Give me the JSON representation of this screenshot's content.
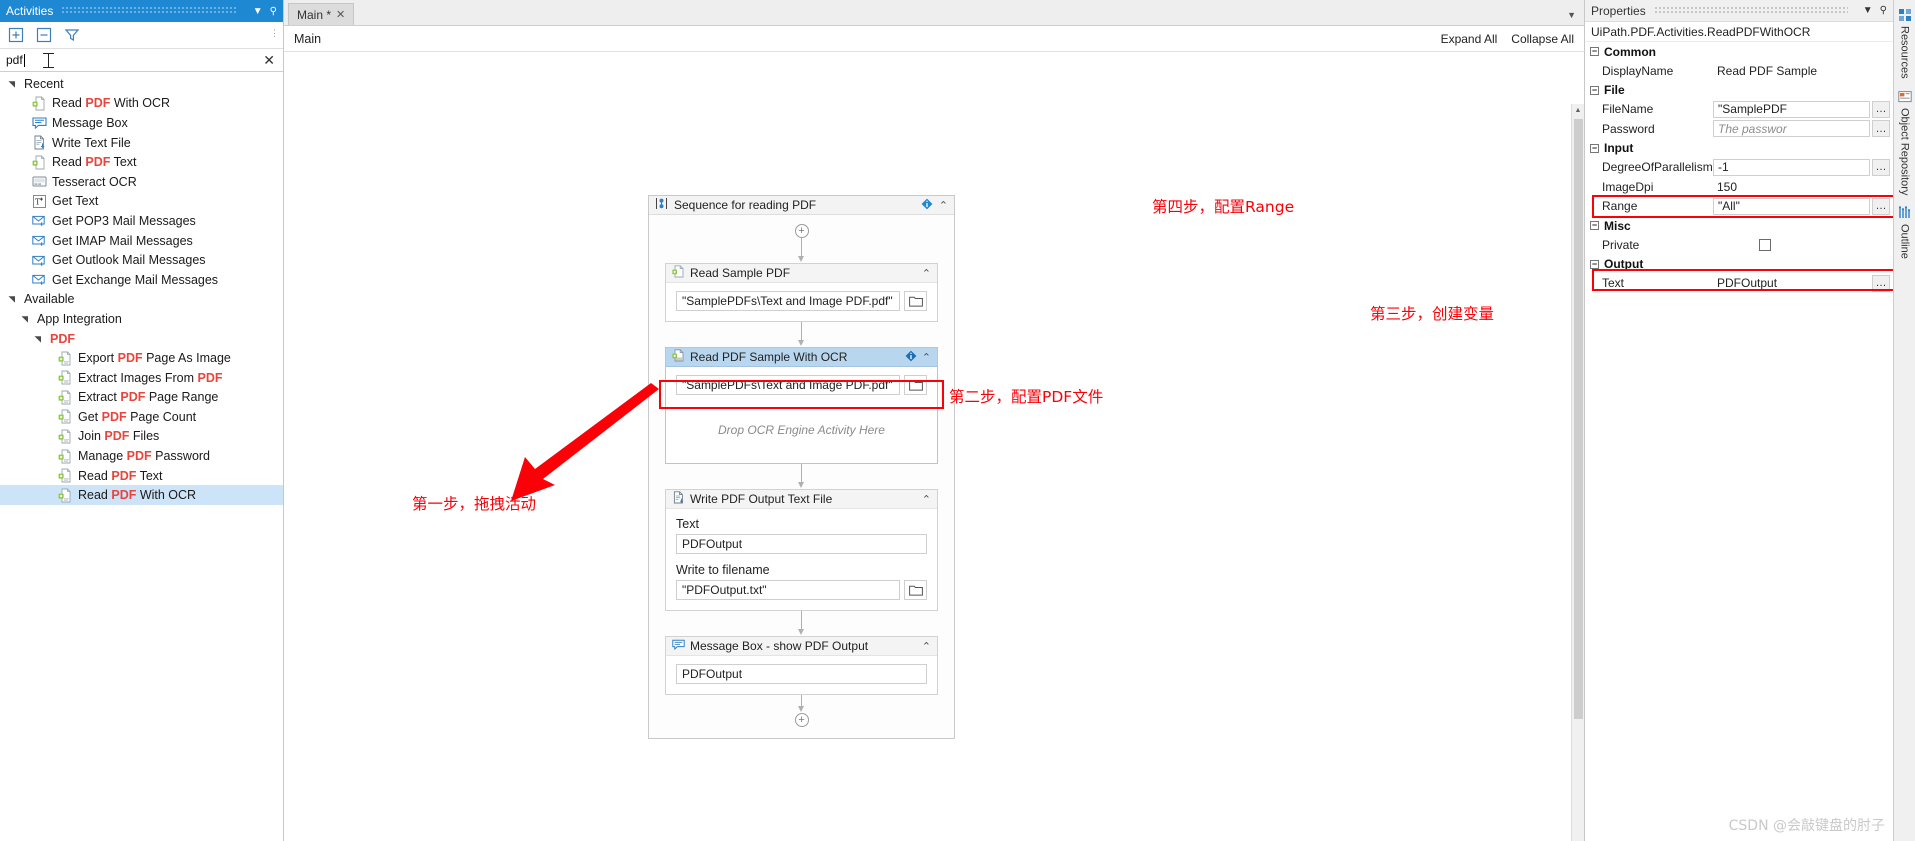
{
  "activities": {
    "title": "Activities",
    "toolbar": {
      "expand_all": "expand-all-icon",
      "collapse_all": "collapse-all-icon",
      "filter": "filter-icon"
    },
    "search": {
      "value": "pdf",
      "clear_label": "✕"
    },
    "tree": [
      {
        "type": "group",
        "label": "Recent",
        "indent": 0,
        "expanded": true
      },
      {
        "type": "item",
        "label": "Read PDF With OCR",
        "indent": 2,
        "icon": "read-pdf-icon"
      },
      {
        "type": "item",
        "label": "Message Box",
        "indent": 2,
        "icon": "message-box-icon"
      },
      {
        "type": "item",
        "label": "Write Text File",
        "indent": 2,
        "icon": "write-text-icon"
      },
      {
        "type": "item",
        "label": "Read PDF Text",
        "indent": 2,
        "icon": "read-pdf-icon"
      },
      {
        "type": "item",
        "label": "Tesseract OCR",
        "indent": 2,
        "icon": "ocr-icon"
      },
      {
        "type": "item",
        "label": "Get Text",
        "indent": 2,
        "icon": "get-text-icon"
      },
      {
        "type": "item",
        "label": "Get POP3 Mail Messages",
        "indent": 2,
        "icon": "mail-icon"
      },
      {
        "type": "item",
        "label": "Get IMAP Mail Messages",
        "indent": 2,
        "icon": "mail-icon"
      },
      {
        "type": "item",
        "label": "Get Outlook Mail Messages",
        "indent": 2,
        "icon": "mail-icon"
      },
      {
        "type": "item",
        "label": "Get Exchange Mail Messages",
        "indent": 2,
        "icon": "mail-icon"
      },
      {
        "type": "group",
        "label": "Available",
        "indent": 0,
        "expanded": true
      },
      {
        "type": "group",
        "label": "App Integration",
        "indent": 1,
        "expanded": true
      },
      {
        "type": "group",
        "label": "PDF",
        "indent": 2,
        "expanded": true,
        "accent": true
      },
      {
        "type": "item",
        "label": "Export PDF Page As Image",
        "indent": 4,
        "icon": "pdf-doc-icon"
      },
      {
        "type": "item",
        "label": "Extract Images From PDF",
        "indent": 4,
        "icon": "pdf-doc-icon"
      },
      {
        "type": "item",
        "label": "Extract PDF Page Range",
        "indent": 4,
        "icon": "pdf-doc-icon"
      },
      {
        "type": "item",
        "label": "Get PDF Page Count",
        "indent": 4,
        "icon": "pdf-doc-icon"
      },
      {
        "type": "item",
        "label": "Join PDF Files",
        "indent": 4,
        "icon": "pdf-doc-icon"
      },
      {
        "type": "item",
        "label": "Manage PDF Password",
        "indent": 4,
        "icon": "pdf-doc-icon"
      },
      {
        "type": "item",
        "label": "Read PDF Text",
        "indent": 4,
        "icon": "pdf-doc-icon"
      },
      {
        "type": "item",
        "label": "Read PDF With OCR",
        "indent": 4,
        "icon": "pdf-doc-icon",
        "selected": true
      }
    ]
  },
  "designer": {
    "tab": {
      "label": "Main *",
      "close": "✕"
    },
    "breadcrumb": "Main",
    "expand_all": "Expand All",
    "collapse_all": "Collapse All",
    "sequence": {
      "title": "Sequence for reading PDF",
      "activities": [
        {
          "title": "Read Sample PDF",
          "file_value": "\"SamplePDFs\\Text and Image PDF.pdf\"",
          "selected": false
        },
        {
          "title": "Read PDF Sample With OCR",
          "file_value": "\"SamplePDFs\\Text and Image PDF.pdf\"",
          "drop_hint": "Drop OCR Engine Activity Here",
          "selected": true
        },
        {
          "title": "Write PDF Output Text File",
          "text_label": "Text",
          "text_value": "PDFOutput",
          "filename_label": "Write to filename",
          "filename_value": "\"PDFOutput.txt\""
        },
        {
          "title": "Message Box - show PDF Output",
          "value": "PDFOutput"
        }
      ]
    }
  },
  "annotations": [
    {
      "id": "step1",
      "text": "第一步，拖拽活动"
    },
    {
      "id": "step2",
      "text": "第二步，配置PDF文件"
    },
    {
      "id": "step3",
      "text": "第三步，创建变量"
    },
    {
      "id": "step4",
      "text": "第四步，配置Range"
    }
  ],
  "properties": {
    "title": "Properties",
    "type_name": "UiPath.PDF.Activities.ReadPDFWithOCR",
    "groups": [
      {
        "name": "Common",
        "rows": [
          {
            "key": "DisplayName",
            "value": "Read PDF Sample",
            "style": "plain"
          }
        ]
      },
      {
        "name": "File",
        "rows": [
          {
            "key": "FileName",
            "value": "\"SamplePDF",
            "style": "boxed",
            "ellipsis": true
          },
          {
            "key": "Password",
            "value": "The passwor",
            "style": "placeholder",
            "ellipsis": true
          }
        ]
      },
      {
        "name": "Input",
        "rows": [
          {
            "key": "DegreeOfParallelism",
            "value": "-1",
            "style": "boxed",
            "ellipsis": true
          },
          {
            "key": "ImageDpi",
            "value": "150",
            "style": "plain"
          },
          {
            "key": "Range",
            "value": "\"All\"",
            "style": "boxed",
            "ellipsis": true,
            "highlight": true
          }
        ]
      },
      {
        "name": "Misc",
        "rows": [
          {
            "key": "Private",
            "value": "",
            "style": "checkbox"
          }
        ]
      },
      {
        "name": "Output",
        "rows": [
          {
            "key": "Text",
            "value": "PDFOutput",
            "style": "plain",
            "ellipsis": true,
            "highlight": true
          }
        ]
      }
    ]
  },
  "rail": [
    {
      "label": "Resources",
      "icon": "resources-icon"
    },
    {
      "label": "Object Repository",
      "icon": "object-repository-icon"
    },
    {
      "label": "Outline",
      "icon": "outline-icon"
    }
  ],
  "watermark": "CSDN @会敲键盘的肘子",
  "colors": {
    "accent_blue": "#1e88d2",
    "selection_blue": "#cde3f7",
    "pdf_red": "#e8453c",
    "annotation_red": "#fb0007"
  }
}
